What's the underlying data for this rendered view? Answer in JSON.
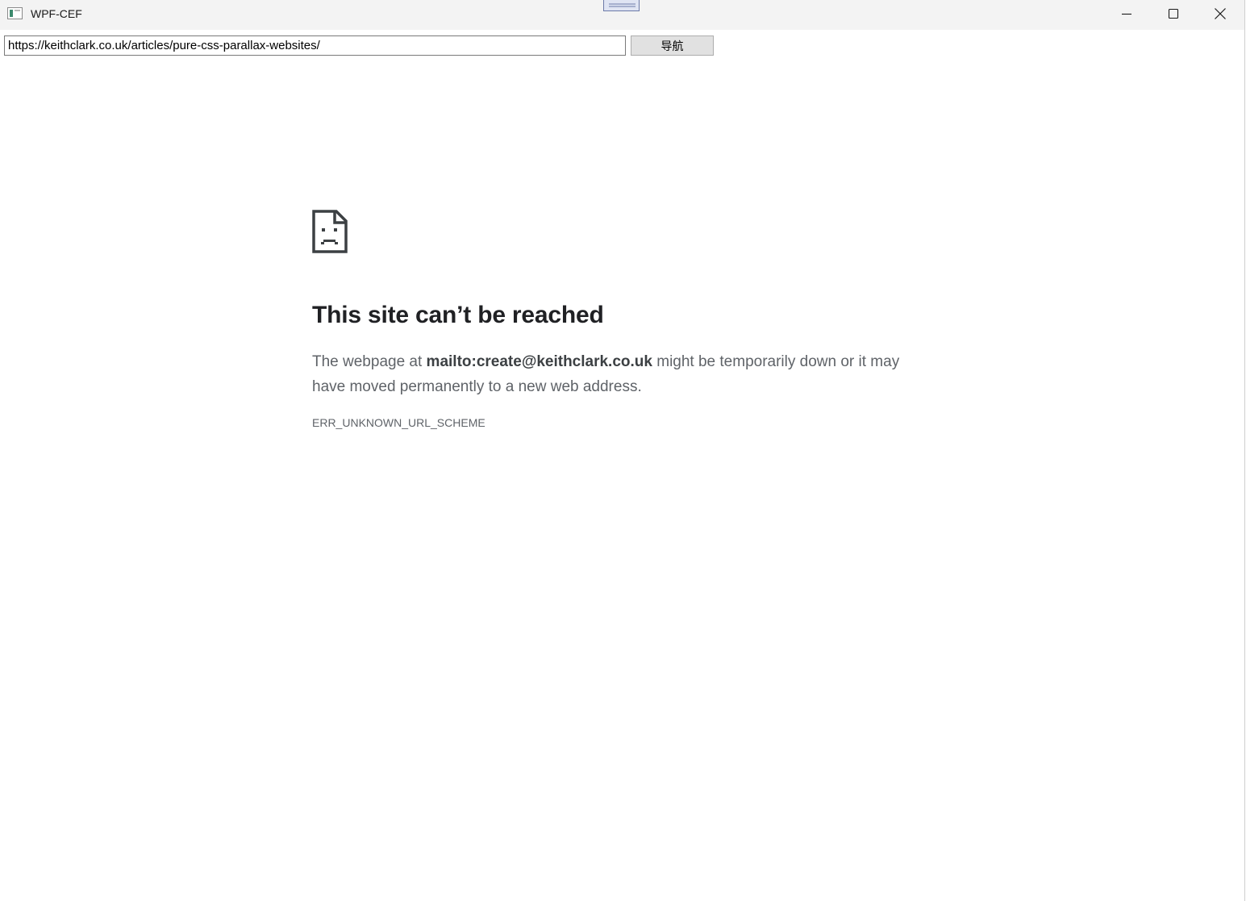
{
  "window": {
    "title": "WPF-CEF"
  },
  "toolbar": {
    "url": "https://keithclark.co.uk/articles/pure-css-parallax-websites/",
    "navigate_label": "导航"
  },
  "error": {
    "heading": "This site can’t be reached",
    "message_prefix": "The webpage at ",
    "url": "mailto:create@keithclark.co.uk",
    "message_suffix": " might be temporarily down or it may have moved permanently to a new web address.",
    "code": "ERR_UNKNOWN_URL_SCHEME",
    "icon": "sad-page-icon"
  },
  "colors": {
    "titlebar_bg": "#f3f3f3",
    "heading": "#202124",
    "body_text": "#5f6368",
    "button_bg": "#e1e1e1"
  }
}
